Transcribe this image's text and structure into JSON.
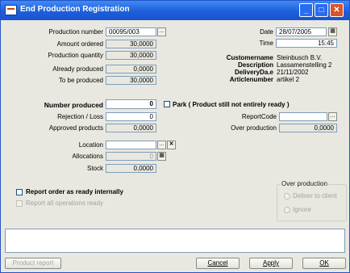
{
  "window": {
    "title": "End Production Registration"
  },
  "left": {
    "production_number_label": "Production number",
    "production_number_value": "00095/003",
    "amount_ordered_label": "Amount ordered",
    "amount_ordered_value": "30,0000",
    "production_quantity_label": "Production quantity",
    "production_quantity_value": "30,0000",
    "already_produced_label": "Already produced",
    "already_produced_value": "0,0000",
    "to_be_produced_label": "To be produced",
    "to_be_produced_value": "30,0000"
  },
  "right": {
    "date_label": "Date",
    "date_value": "28/07/2005",
    "time_label": "Time",
    "time_value": "15:45",
    "customername_label": "Customername",
    "customername_value": "Steinbusch B.V.",
    "description_label": "Description",
    "description_value": "Lassamenstelling 2",
    "deliverydate_label": "DeliveryDa.e",
    "deliverydate_value": "21/11/2002",
    "articlenumber_label": "Articlenumber",
    "articlenumber_value": "artikel 2"
  },
  "entry": {
    "number_produced_label": "Number produced",
    "number_produced_value": "0",
    "park_label": "Park ( Product still not entirely ready )",
    "rejection_label": "Rejection / Loss",
    "rejection_value": "0",
    "approved_label": "Approved products",
    "approved_value": "0,0000",
    "reportcode_label": "ReportCode",
    "reportcode_value": "",
    "over_production_label": "Over production",
    "over_production_value": "0,0000",
    "location_label": "Location",
    "location_value": "",
    "allocations_label": "Allocations",
    "allocations_value": "0",
    "stock_label": "Stock",
    "stock_value": "0,0000"
  },
  "options": {
    "report_ready_label": "Report order as ready internally",
    "report_all_label": "Report all operations ready",
    "overprod_group_title": "Over production",
    "deliver_client_label": "Deliver to client",
    "ignore_label": "Ignore"
  },
  "buttons": {
    "product_report": "Product report",
    "cancel": "Cancel",
    "apply": "Apply",
    "ok": "OK",
    "lookup_symbol": "...",
    "clear_symbol": "✕"
  },
  "icons": {
    "app": "app-window-icon",
    "minimize": "minimize-icon",
    "maximize": "maximize-icon",
    "close": "close-icon",
    "calendar": "calendar-icon",
    "allocations": "grid-icon"
  },
  "colors": {
    "titlebar": "#1d5fdc",
    "close": "#d8532c",
    "window": "#e9e8e0"
  }
}
